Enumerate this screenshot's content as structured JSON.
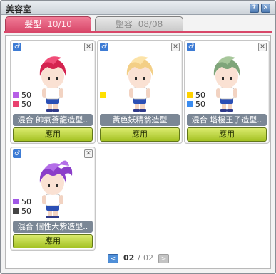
{
  "window": {
    "title": "美容室",
    "help_icon": "help-icon",
    "close_icon": "close-icon"
  },
  "tabs": [
    {
      "label": "髮型",
      "count": "10/10",
      "active": true
    },
    {
      "label": "整容",
      "count": "08/08",
      "active": false
    }
  ],
  "cards": [
    {
      "gender_icon": "male-icon",
      "stats": [
        {
          "value": "50",
          "color": "#b65ee6"
        },
        {
          "value": "50",
          "color": "#e9416f"
        }
      ],
      "name": "混合 帥氣蒼龍造型..",
      "apply_label": "應用",
      "hair_color": "#d4234f",
      "hair_color_2": "#f04d78"
    },
    {
      "gender_icon": "male-icon",
      "stats": [
        {
          "value": "",
          "color": "#ffe000"
        }
      ],
      "name": "黃色妖精翁造型",
      "apply_label": "應用",
      "hair_color": "#f3cf86",
      "hair_color_2": "#fce3a8"
    },
    {
      "gender_icon": "male-icon",
      "stats": [
        {
          "value": "50",
          "color": "#ffd200"
        },
        {
          "value": "50",
          "color": "#3a8cf0"
        }
      ],
      "name": "混合 塔樓王子造型..",
      "apply_label": "應用",
      "hair_color": "#7fa57a",
      "hair_color_2": "#a7c79b"
    },
    {
      "gender_icon": "male-icon",
      "stats": [
        {
          "value": "50",
          "color": "#a058e6"
        },
        {
          "value": "50",
          "color": "#444444"
        }
      ],
      "name": "混合 個性大紫造型..",
      "apply_label": "應用",
      "hair_color": "#8b3ec9",
      "hair_color_2": "#b46ee8"
    }
  ],
  "pager": {
    "current": "02",
    "total": "02",
    "prev_icon": "chevron-left-icon",
    "next_icon": "chevron-right-icon"
  }
}
